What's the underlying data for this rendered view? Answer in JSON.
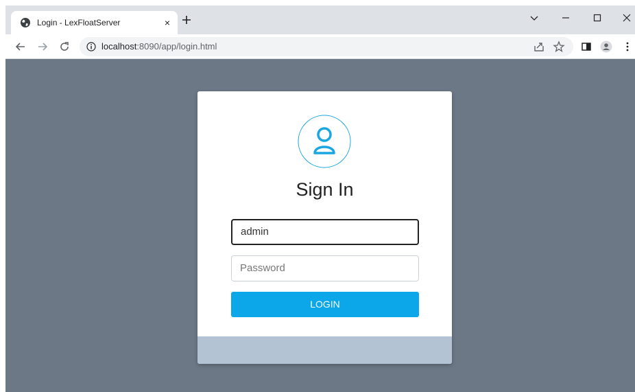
{
  "browser": {
    "tab_title": "Login - LexFloatServer",
    "tab_close": "×",
    "url_host": "localhost",
    "url_rest": ":8090/app/login.html",
    "icons": {
      "favicon": "globe-icon",
      "new_tab": "plus-icon",
      "back": "arrow-left-icon",
      "forward": "arrow-right-icon",
      "reload": "reload-icon",
      "site_info": "info-icon",
      "share": "share-icon",
      "bookmark": "star-icon",
      "side_panel": "side-panel-icon",
      "profile": "profile-icon",
      "menu": "kebab-menu-icon",
      "tab_search": "chevron-down-icon",
      "minimize": "minimize-icon",
      "maximize": "maximize-icon",
      "close_window": "close-icon"
    }
  },
  "login": {
    "heading": "Sign In",
    "username_value": "admin",
    "password_placeholder": "Password",
    "button_label": "LOGIN",
    "avatar_icon": "user-icon"
  },
  "colors": {
    "page_background": "#6c7886",
    "button": "#0ba7e8",
    "card_footer": "#b3c3d3",
    "avatar_accent": "#1aa6e0"
  }
}
